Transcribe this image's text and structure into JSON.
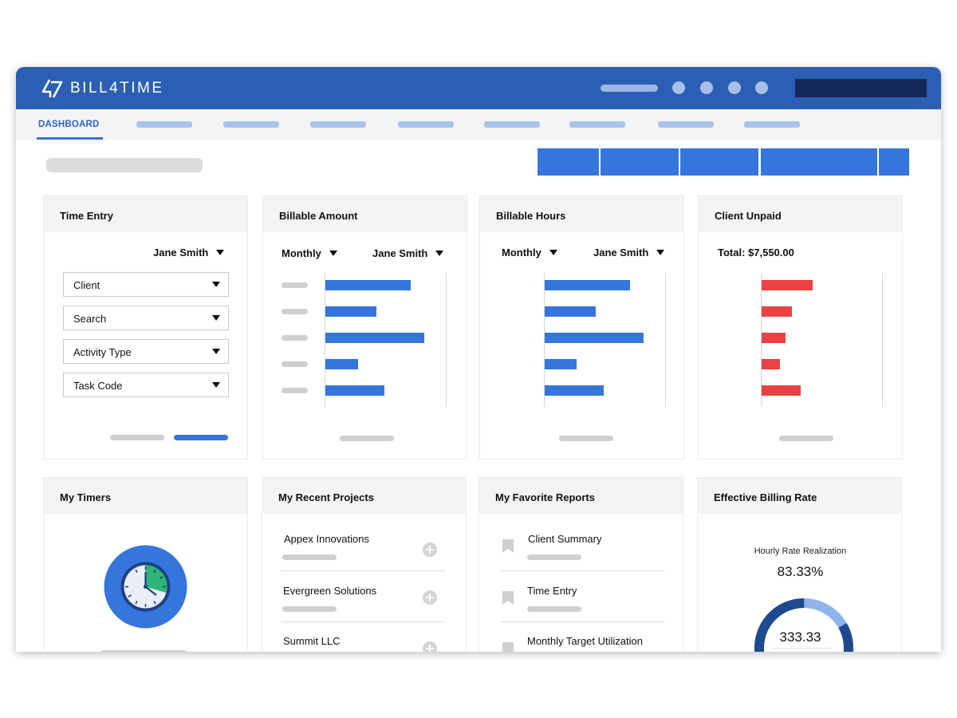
{
  "app": {
    "name": "BILL4TIME",
    "logo_mark": "47"
  },
  "nav": {
    "active_tab": "DASHBOARD"
  },
  "time_entry": {
    "title": "Time Entry",
    "user": "Jane Smith",
    "fields": [
      "Client",
      "Search",
      "Activity Type",
      "Task Code"
    ]
  },
  "billable_amount": {
    "title": "Billable Amount",
    "period": "Monthly",
    "user": "Jane Smith",
    "chart_data": {
      "type": "bar",
      "orientation": "horizontal",
      "values": [
        107,
        64,
        124,
        41,
        74
      ],
      "color": "#3476dc"
    }
  },
  "billable_hours": {
    "title": "Billable Hours",
    "period": "Monthly",
    "user": "Jane Smith",
    "chart_data": {
      "type": "bar",
      "orientation": "horizontal",
      "values": [
        107,
        64,
        124,
        40,
        74
      ],
      "color": "#3476dc"
    }
  },
  "client_unpaid": {
    "title": "Client Unpaid",
    "total": "Total: $7,550.00",
    "chart_data": {
      "type": "bar",
      "orientation": "horizontal",
      "values": [
        64,
        38,
        30,
        23,
        49
      ],
      "color": "#e94242"
    }
  },
  "my_timers": {
    "title": "My Timers",
    "icon": "clock-icon"
  },
  "recent_projects": {
    "title": "My Recent Projects",
    "items": [
      "Appex Innovations",
      "Evergreen Solutions",
      "Summit LLC"
    ]
  },
  "favorite_reports": {
    "title": "My Favorite Reports",
    "items": [
      "Client Summary",
      "Time Entry",
      "Monthly Target Utilization"
    ]
  },
  "billing_rate": {
    "title": "Effective Billing Rate",
    "subtitle": "Hourly Rate Realization",
    "percent": "83.33%",
    "gauge_value": "333.33",
    "gauge_fraction": 0.8333
  },
  "colors": {
    "brand": "#2c5fb3",
    "accent": "#3476dc",
    "unpaid": "#e94242",
    "timer_green": "#2bb673"
  }
}
